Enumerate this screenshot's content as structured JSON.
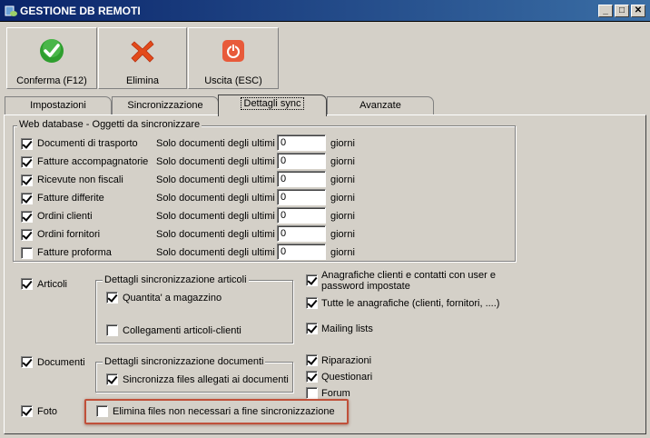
{
  "window": {
    "title": "GESTIONE DB REMOTI",
    "controls": [
      "_",
      "□",
      "✕"
    ]
  },
  "toolbar": {
    "confirm_label": "Conferma (F12)",
    "delete_label": "Elimina",
    "exit_label": "Uscita (ESC)"
  },
  "tabs": [
    {
      "label": "Impostazioni"
    },
    {
      "label": "Sincronizzazione"
    },
    {
      "label": "Dettagli sync"
    },
    {
      "label": "Avanzate"
    }
  ],
  "web_group": {
    "title": "Web database - Oggetti da sincronizzare",
    "prefix": "Solo documenti degli ultimi",
    "unit": "giorni",
    "rows": [
      {
        "label": "Documenti di trasporto",
        "checked": true,
        "days": "0"
      },
      {
        "label": "Fatture accompagnatorie",
        "checked": true,
        "days": "0"
      },
      {
        "label": "Ricevute non fiscali",
        "checked": true,
        "days": "0"
      },
      {
        "label": "Fatture differite",
        "checked": true,
        "days": "0"
      },
      {
        "label": "Ordini clienti",
        "checked": true,
        "days": "0"
      },
      {
        "label": "Ordini fornitori",
        "checked": true,
        "days": "0"
      },
      {
        "label": "Fatture proforma",
        "checked": false,
        "days": "0"
      }
    ]
  },
  "articoli": {
    "label": "Articoli",
    "checked": true
  },
  "articoli_details": {
    "title": "Dettagli sincronizzazione articoli",
    "quantita": {
      "label": "Quantita' a magazzino",
      "checked": true
    },
    "collegamenti": {
      "label": "Collegamenti articoli-clienti",
      "checked": false
    }
  },
  "documenti": {
    "label": "Documenti",
    "checked": true
  },
  "documenti_details": {
    "title": "Dettagli sincronizzazione documenti",
    "allegati": {
      "label": "Sincronizza files allegati ai documenti",
      "checked": true
    }
  },
  "foto": {
    "label": "Foto",
    "checked": true
  },
  "elimina_files": {
    "label": "Elimina files non necessari a fine sincronizzazione",
    "checked": false
  },
  "right_options": {
    "anagrafiche_line1": "Anagrafiche clienti e contatti con user e",
    "anagrafiche_line2": "password impostate",
    "anagrafiche_checked": true,
    "tutte": {
      "label": "Tutte le anagrafiche (clienti, fornitori, ....)",
      "checked": true
    },
    "mailing": {
      "label": "Mailing lists",
      "checked": true
    },
    "riparazioni": {
      "label": "Riparazioni",
      "checked": true
    },
    "questionari": {
      "label": "Questionari",
      "checked": true
    },
    "forum": {
      "label": "Forum",
      "checked": false
    }
  },
  "colors": {
    "title_bar": "#0a246a",
    "confirm_icon": "#2e9e2e",
    "delete_icon": "#e34a1a",
    "exit_icon": "#e85a3a",
    "highlight": "#c0503a"
  }
}
